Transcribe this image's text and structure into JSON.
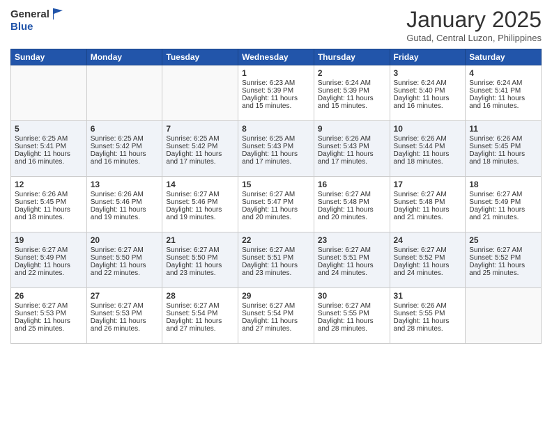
{
  "header": {
    "logo_line1": "General",
    "logo_line2": "Blue",
    "month": "January 2025",
    "location": "Gutad, Central Luzon, Philippines"
  },
  "days_of_week": [
    "Sunday",
    "Monday",
    "Tuesday",
    "Wednesday",
    "Thursday",
    "Friday",
    "Saturday"
  ],
  "weeks": [
    [
      {
        "day": "",
        "info": ""
      },
      {
        "day": "",
        "info": ""
      },
      {
        "day": "",
        "info": ""
      },
      {
        "day": "1",
        "info": "Sunrise: 6:23 AM\nSunset: 5:39 PM\nDaylight: 11 hours and 15 minutes."
      },
      {
        "day": "2",
        "info": "Sunrise: 6:24 AM\nSunset: 5:39 PM\nDaylight: 11 hours and 15 minutes."
      },
      {
        "day": "3",
        "info": "Sunrise: 6:24 AM\nSunset: 5:40 PM\nDaylight: 11 hours and 16 minutes."
      },
      {
        "day": "4",
        "info": "Sunrise: 6:24 AM\nSunset: 5:41 PM\nDaylight: 11 hours and 16 minutes."
      }
    ],
    [
      {
        "day": "5",
        "info": "Sunrise: 6:25 AM\nSunset: 5:41 PM\nDaylight: 11 hours and 16 minutes."
      },
      {
        "day": "6",
        "info": "Sunrise: 6:25 AM\nSunset: 5:42 PM\nDaylight: 11 hours and 16 minutes."
      },
      {
        "day": "7",
        "info": "Sunrise: 6:25 AM\nSunset: 5:42 PM\nDaylight: 11 hours and 17 minutes."
      },
      {
        "day": "8",
        "info": "Sunrise: 6:25 AM\nSunset: 5:43 PM\nDaylight: 11 hours and 17 minutes."
      },
      {
        "day": "9",
        "info": "Sunrise: 6:26 AM\nSunset: 5:43 PM\nDaylight: 11 hours and 17 minutes."
      },
      {
        "day": "10",
        "info": "Sunrise: 6:26 AM\nSunset: 5:44 PM\nDaylight: 11 hours and 18 minutes."
      },
      {
        "day": "11",
        "info": "Sunrise: 6:26 AM\nSunset: 5:45 PM\nDaylight: 11 hours and 18 minutes."
      }
    ],
    [
      {
        "day": "12",
        "info": "Sunrise: 6:26 AM\nSunset: 5:45 PM\nDaylight: 11 hours and 18 minutes."
      },
      {
        "day": "13",
        "info": "Sunrise: 6:26 AM\nSunset: 5:46 PM\nDaylight: 11 hours and 19 minutes."
      },
      {
        "day": "14",
        "info": "Sunrise: 6:27 AM\nSunset: 5:46 PM\nDaylight: 11 hours and 19 minutes."
      },
      {
        "day": "15",
        "info": "Sunrise: 6:27 AM\nSunset: 5:47 PM\nDaylight: 11 hours and 20 minutes."
      },
      {
        "day": "16",
        "info": "Sunrise: 6:27 AM\nSunset: 5:48 PM\nDaylight: 11 hours and 20 minutes."
      },
      {
        "day": "17",
        "info": "Sunrise: 6:27 AM\nSunset: 5:48 PM\nDaylight: 11 hours and 21 minutes."
      },
      {
        "day": "18",
        "info": "Sunrise: 6:27 AM\nSunset: 5:49 PM\nDaylight: 11 hours and 21 minutes."
      }
    ],
    [
      {
        "day": "19",
        "info": "Sunrise: 6:27 AM\nSunset: 5:49 PM\nDaylight: 11 hours and 22 minutes."
      },
      {
        "day": "20",
        "info": "Sunrise: 6:27 AM\nSunset: 5:50 PM\nDaylight: 11 hours and 22 minutes."
      },
      {
        "day": "21",
        "info": "Sunrise: 6:27 AM\nSunset: 5:50 PM\nDaylight: 11 hours and 23 minutes."
      },
      {
        "day": "22",
        "info": "Sunrise: 6:27 AM\nSunset: 5:51 PM\nDaylight: 11 hours and 23 minutes."
      },
      {
        "day": "23",
        "info": "Sunrise: 6:27 AM\nSunset: 5:51 PM\nDaylight: 11 hours and 24 minutes."
      },
      {
        "day": "24",
        "info": "Sunrise: 6:27 AM\nSunset: 5:52 PM\nDaylight: 11 hours and 24 minutes."
      },
      {
        "day": "25",
        "info": "Sunrise: 6:27 AM\nSunset: 5:52 PM\nDaylight: 11 hours and 25 minutes."
      }
    ],
    [
      {
        "day": "26",
        "info": "Sunrise: 6:27 AM\nSunset: 5:53 PM\nDaylight: 11 hours and 25 minutes."
      },
      {
        "day": "27",
        "info": "Sunrise: 6:27 AM\nSunset: 5:53 PM\nDaylight: 11 hours and 26 minutes."
      },
      {
        "day": "28",
        "info": "Sunrise: 6:27 AM\nSunset: 5:54 PM\nDaylight: 11 hours and 27 minutes."
      },
      {
        "day": "29",
        "info": "Sunrise: 6:27 AM\nSunset: 5:54 PM\nDaylight: 11 hours and 27 minutes."
      },
      {
        "day": "30",
        "info": "Sunrise: 6:27 AM\nSunset: 5:55 PM\nDaylight: 11 hours and 28 minutes."
      },
      {
        "day": "31",
        "info": "Sunrise: 6:26 AM\nSunset: 5:55 PM\nDaylight: 11 hours and 28 minutes."
      },
      {
        "day": "",
        "info": ""
      }
    ]
  ]
}
